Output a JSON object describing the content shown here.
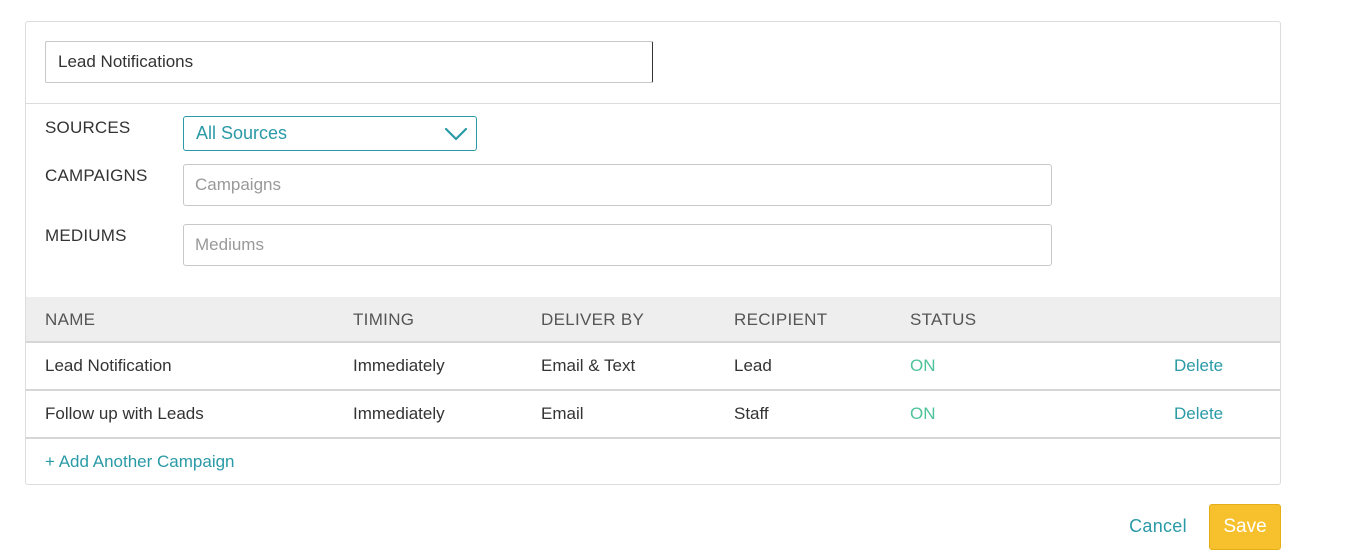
{
  "form": {
    "name_value": "Lead Notifications"
  },
  "filters": {
    "sources_label": "SOURCES",
    "sources_selected": "All Sources",
    "campaigns_label": "CAMPAIGNS",
    "campaigns_placeholder": "Campaigns",
    "mediums_label": "MEDIUMS",
    "mediums_placeholder": "Mediums"
  },
  "table": {
    "headers": {
      "name": "NAME",
      "timing": "TIMING",
      "deliver_by": "DELIVER BY",
      "recipient": "RECIPIENT",
      "status": "STATUS"
    },
    "rows": [
      {
        "name": "Lead Notification",
        "timing": "Immediately",
        "deliver_by": "Email & Text",
        "recipient": "Lead",
        "status": "ON",
        "action": "Delete"
      },
      {
        "name": "Follow up with Leads",
        "timing": "Immediately",
        "deliver_by": "Email",
        "recipient": "Staff",
        "status": "ON",
        "action": "Delete"
      }
    ]
  },
  "add_campaign_label": "+ Add Another Campaign",
  "actions": {
    "cancel_label": "Cancel",
    "save_label": "Save"
  },
  "colors": {
    "accent": "#2a9aa6",
    "status_on": "#4fc39a",
    "save_button": "#f7c12e"
  },
  "icons": {
    "select_toggle": "chevron-down-icon"
  }
}
